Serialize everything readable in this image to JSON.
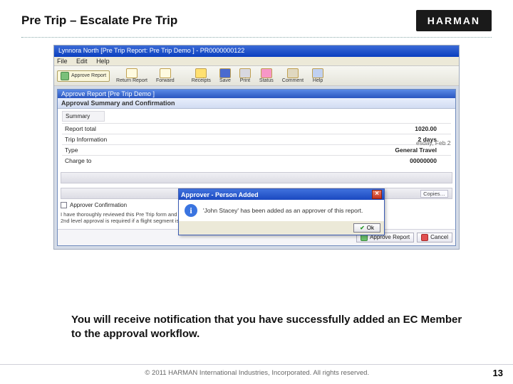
{
  "slide": {
    "title": "Pre Trip – Escalate Pre Trip",
    "caption": "You will receive notification that you have successfully added an EC Member to the approval workflow.",
    "brand": "HARMAN",
    "page_number": "13",
    "copyright": "© 2011 HARMAN International Industries, Incorporated.  All rights reserved."
  },
  "app": {
    "titlebar": "Lynnora North [Pre Trip Report: Pre Trip Demo ] - PR0000000122",
    "menus": {
      "file": "File",
      "edit": "Edit",
      "help": "Help"
    },
    "toolbar": {
      "approve": "Approve Report",
      "return": "Return Report",
      "forward": "Forward",
      "receipts": "Receipts",
      "save": "Save",
      "print": "Print",
      "status": "Status",
      "comment": "Comment",
      "help": "Help"
    },
    "inner": {
      "window_title": "Approve Report [Pre Trip Demo ]",
      "approval_header": "Approval Summary and Confirmation",
      "summary_label": "Summary",
      "rows": {
        "total_label": "Report total",
        "total_value": "1020.00",
        "trip_label": "Trip Information",
        "trip_value": "2 days",
        "type_label": "Type",
        "type_value": "General Travel",
        "charge_label": "Charge to",
        "charge_value": "00000000"
      },
      "band2_dd": "Copies…",
      "approver_confirm": "Approver Confirmation",
      "fine1": "I have thoroughly reviewed this Pre Trip form and have added a 2nd level approver, if required.",
      "fine2": "2nd level approval is required if a flight segment is greater than 4 hours or trip request is less than 7 days in advance.",
      "footer_btns": {
        "approve": "Approve Report",
        "cancel": "Cancel"
      }
    },
    "rightside_date": "esday, Feb 2"
  },
  "popup": {
    "title": "Approver - Person Added",
    "message": "'John Stacey' has been added as an approver of this report.",
    "ok": "Ok"
  }
}
